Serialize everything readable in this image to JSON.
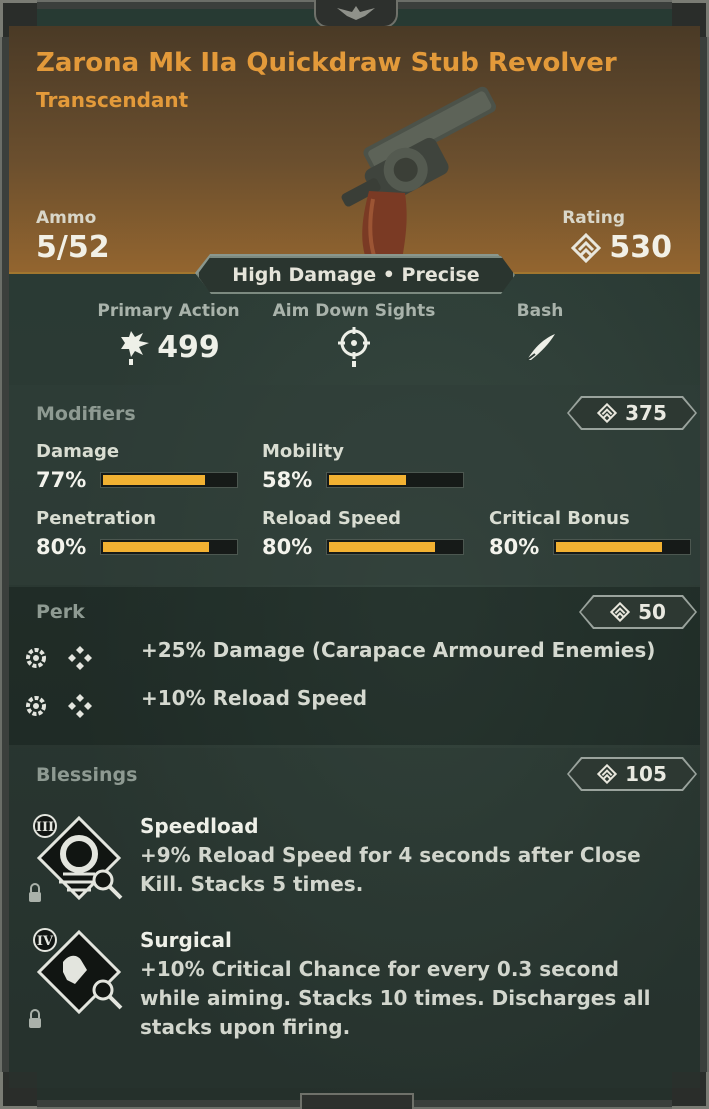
{
  "weapon": {
    "name": "Zarona Mk IIa Quickdraw Stub Revolver",
    "rarity": "Transcendant",
    "ammo_label": "Ammo",
    "ammo_value": "5/52",
    "rating_label": "Rating",
    "rating_value": "530",
    "tagline": "High Damage • Precise"
  },
  "actions": [
    {
      "label": "Primary Action",
      "value": "499",
      "icon": "burst-shot-icon"
    },
    {
      "label": "Aim Down Sights",
      "value": "",
      "icon": "crosshair-icon"
    },
    {
      "label": "Bash",
      "value": "",
      "icon": "blade-swipe-icon"
    }
  ],
  "modifiers": {
    "title": "Modifiers",
    "rating": "375",
    "stats": [
      {
        "label": "Damage",
        "value": "77%",
        "fill": 0.77
      },
      {
        "label": "Mobility",
        "value": "58%",
        "fill": 0.58
      },
      {
        "label": "Penetration",
        "value": "80%",
        "fill": 0.8
      },
      {
        "label": "Reload Speed",
        "value": "80%",
        "fill": 0.8
      },
      {
        "label": "Critical Bonus",
        "value": "80%",
        "fill": 0.8
      }
    ]
  },
  "perk": {
    "title": "Perk",
    "rating": "50",
    "items": [
      {
        "text": "+25% Damage (Carapace Armoured Enemies)"
      },
      {
        "text": "+10% Reload Speed"
      }
    ]
  },
  "blessings": {
    "title": "Blessings",
    "rating": "105",
    "items": [
      {
        "tier": "III",
        "name": "Speedload",
        "description": "+9% Reload Speed for 4 seconds after Close Kill. Stacks 5 times."
      },
      {
        "tier": "IV",
        "name": "Surgical",
        "description": "+10% Critical Chance for every 0.3 second while aiming. Stacks 10 times. Discharges all stacks upon firing."
      }
    ]
  },
  "colors": {
    "accent_orange": "#e39a3a",
    "bar_fill": "#f2b132",
    "header_bg": "#93652f"
  }
}
